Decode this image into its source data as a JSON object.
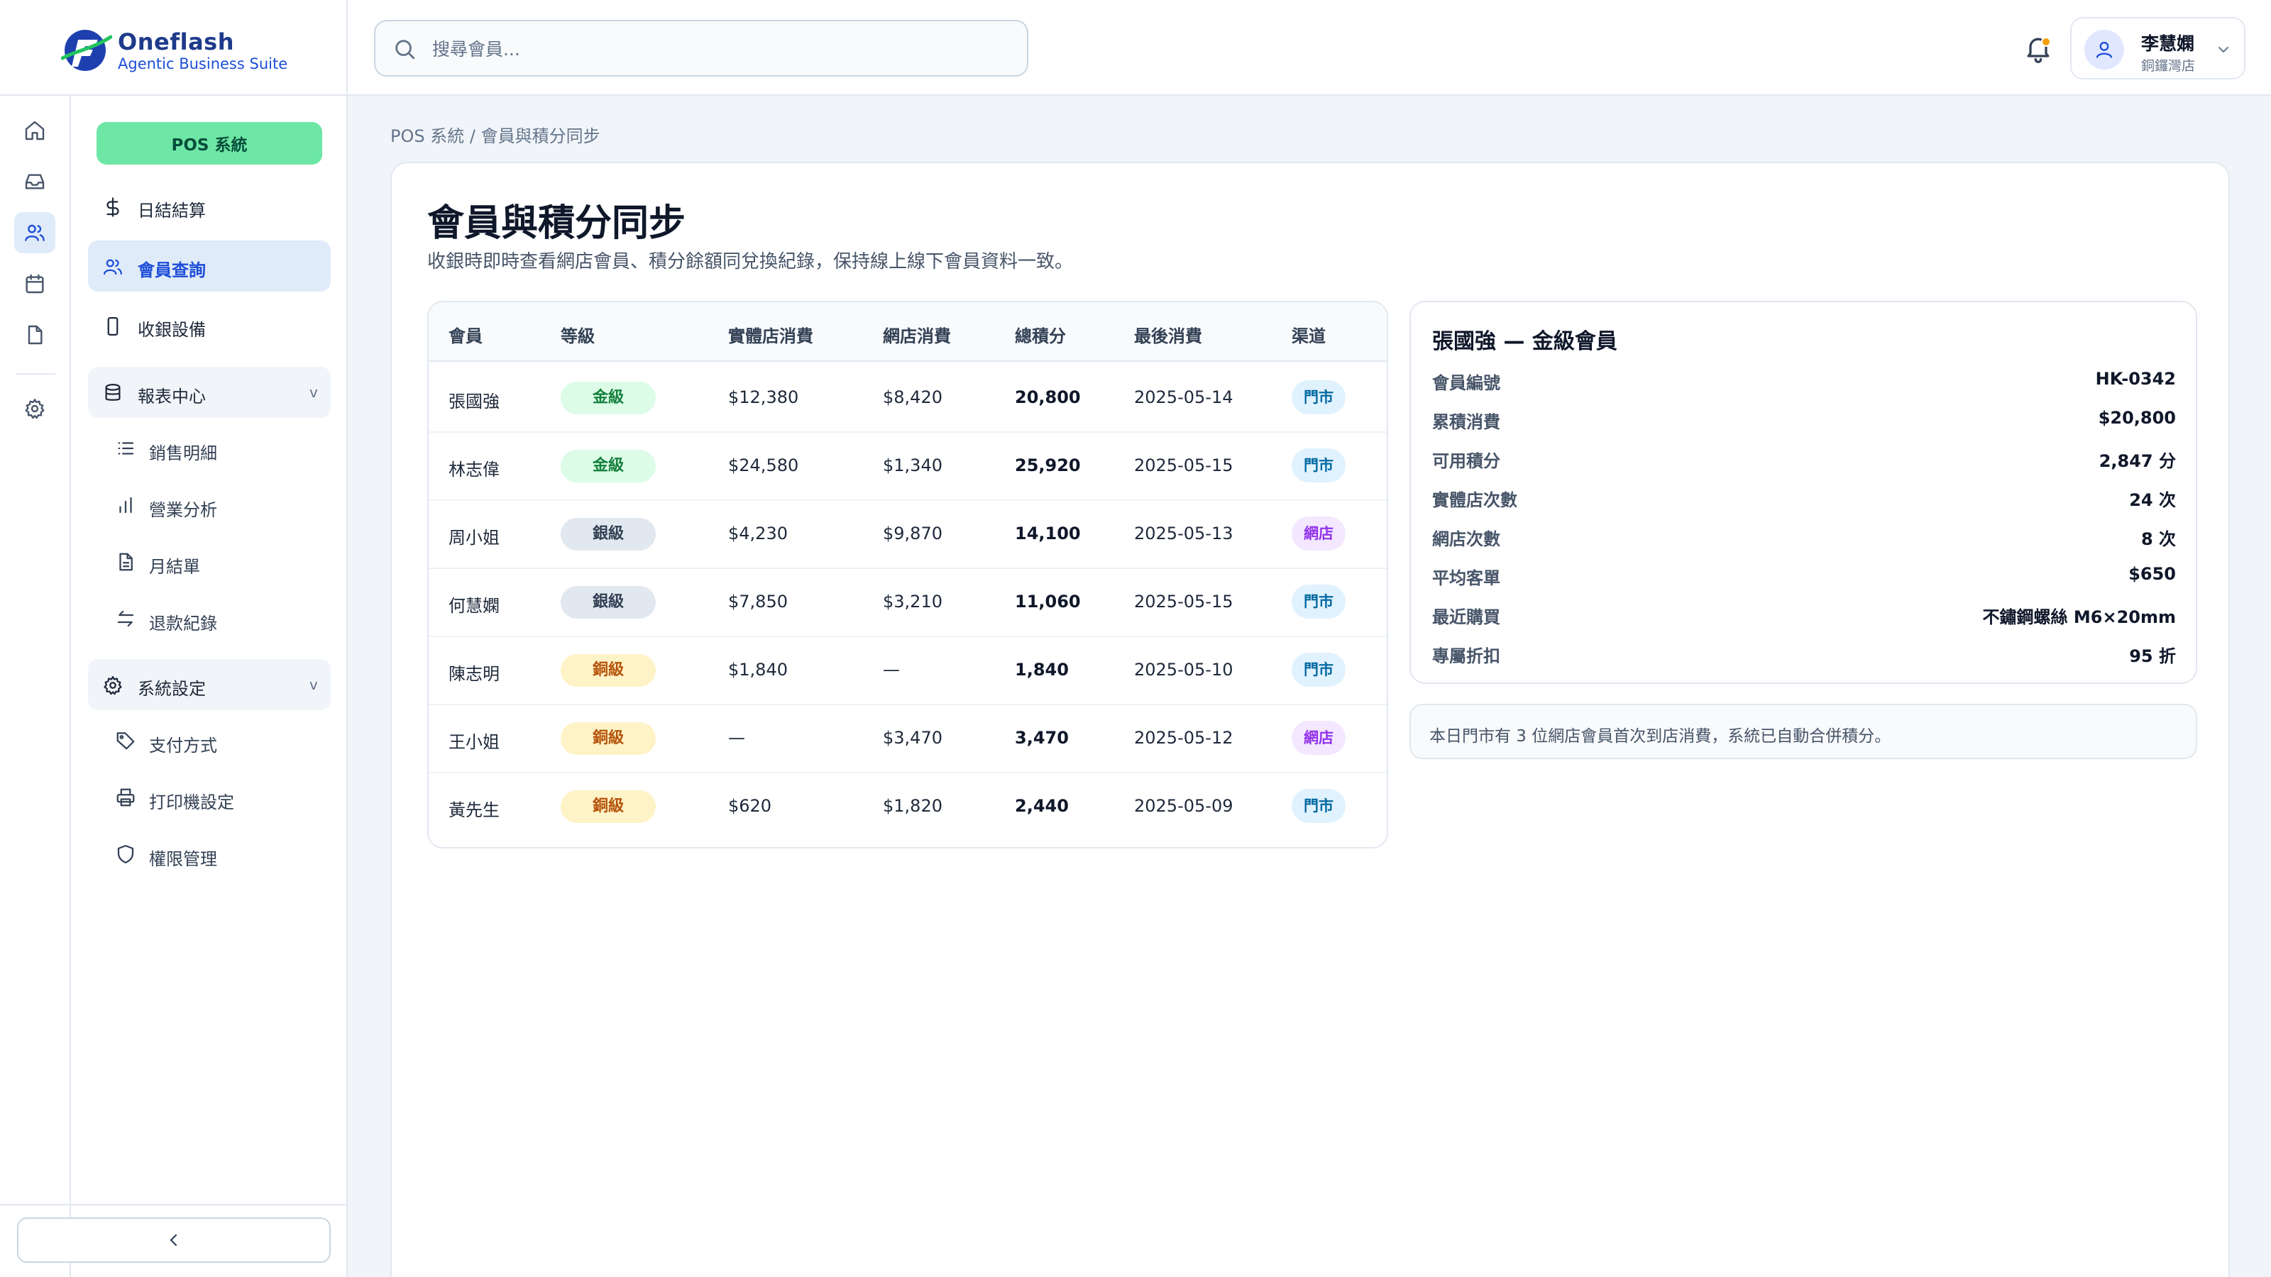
{
  "brand": {
    "name": "Oneflash",
    "tagline": "Agentic Business Suite"
  },
  "search": {
    "placeholder": "搜尋會員..."
  },
  "user": {
    "name": "李慧嫻",
    "store": "銅鑼灣店"
  },
  "nav": {
    "pos_button": "POS 系統",
    "items": [
      {
        "label": "日結結算"
      },
      {
        "label": "會員查詢"
      },
      {
        "label": "收銀設備"
      }
    ],
    "reports": {
      "label": "報表中心",
      "chevron": "v",
      "items": [
        {
          "label": "銷售明細"
        },
        {
          "label": "營業分析"
        },
        {
          "label": "月結單"
        },
        {
          "label": "退款紀錄"
        }
      ]
    },
    "settings": {
      "label": "系統設定",
      "chevron": "v",
      "items": [
        {
          "label": "支付方式"
        },
        {
          "label": "打印機設定"
        },
        {
          "label": "權限管理"
        }
      ]
    }
  },
  "breadcrumb": "POS 系統 / 會員與積分同步",
  "page": {
    "title": "會員與積分同步",
    "subtitle": "收銀時即時查看網店會員、積分餘額同兌換紀錄，保持線上線下會員資料一致。"
  },
  "table": {
    "headers": [
      "會員",
      "等級",
      "實體店消費",
      "網店消費",
      "總積分",
      "最後消費",
      "渠道"
    ],
    "rows": [
      {
        "name": "張國強",
        "tier": "金級",
        "tier_type": "gold",
        "store": "$12,380",
        "online": "$8,420",
        "points": "20,800",
        "last": "2025-05-14",
        "channel": "門市",
        "channel_type": "store"
      },
      {
        "name": "林志偉",
        "tier": "金級",
        "tier_type": "gold",
        "store": "$24,580",
        "online": "$1,340",
        "points": "25,920",
        "last": "2025-05-15",
        "channel": "門市",
        "channel_type": "store"
      },
      {
        "name": "周小姐",
        "tier": "銀級",
        "tier_type": "silver",
        "store": "$4,230",
        "online": "$9,870",
        "points": "14,100",
        "last": "2025-05-13",
        "channel": "網店",
        "channel_type": "online"
      },
      {
        "name": "何慧嫻",
        "tier": "銀級",
        "tier_type": "silver",
        "store": "$7,850",
        "online": "$3,210",
        "points": "11,060",
        "last": "2025-05-15",
        "channel": "門市",
        "channel_type": "store"
      },
      {
        "name": "陳志明",
        "tier": "銅級",
        "tier_type": "bronze",
        "store": "$1,840",
        "online": "—",
        "points": "1,840",
        "last": "2025-05-10",
        "channel": "門市",
        "channel_type": "store"
      },
      {
        "name": "王小姐",
        "tier": "銅級",
        "tier_type": "bronze",
        "store": "—",
        "online": "$3,470",
        "points": "3,470",
        "last": "2025-05-12",
        "channel": "網店",
        "channel_type": "online"
      },
      {
        "name": "黃先生",
        "tier": "銅級",
        "tier_type": "bronze",
        "store": "$620",
        "online": "$1,820",
        "points": "2,440",
        "last": "2025-05-09",
        "channel": "門市",
        "channel_type": "store"
      }
    ]
  },
  "detail": {
    "title": "張國強 — 金級會員",
    "fields": [
      {
        "label": "會員編號",
        "value": "HK-0342"
      },
      {
        "label": "累積消費",
        "value": "$20,800"
      },
      {
        "label": "可用積分",
        "value": "2,847 分"
      },
      {
        "label": "實體店次數",
        "value": "24 次"
      },
      {
        "label": "網店次數",
        "value": "8 次"
      },
      {
        "label": "平均客單",
        "value": "$650"
      },
      {
        "label": "最近購買",
        "value": "不鏽鋼螺絲 M6×20mm"
      },
      {
        "label": "專屬折扣",
        "value": "95 折"
      }
    ]
  },
  "notice": "本日門市有 3 位網店會員首次到店消費，系統已自動合併積分。",
  "colors": {
    "accent": "#1d4ed8",
    "pos_green": "#6ee7a6",
    "gold_badge": "#dcfce7",
    "silver_badge": "#e2e8f0",
    "bronze_badge": "#fef3c7",
    "store_channel": "#e0f2fe",
    "online_channel": "#f3e8ff",
    "notification_dot": "#f59e0b"
  },
  "icons": {
    "rail": [
      "home-icon",
      "inbox-icon",
      "users-icon",
      "calendar-icon",
      "file-icon",
      "gear-icon"
    ],
    "nav": [
      "dollar-icon",
      "users-icon",
      "phone-icon",
      "database-icon",
      "list-icon",
      "bar-chart-icon",
      "document-icon",
      "refund-icon",
      "gear-icon",
      "tag-icon",
      "printer-icon",
      "shield-icon"
    ]
  }
}
